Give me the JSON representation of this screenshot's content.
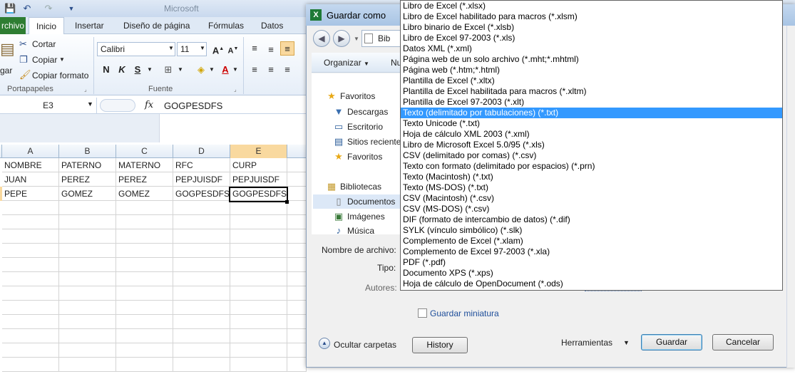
{
  "excel": {
    "title": "Microsoft",
    "tabs": {
      "file": "rchivo",
      "inicio": "Inicio",
      "insertar": "Insertar",
      "diseno": "Diseño de página",
      "formulas": "Fórmulas",
      "datos": "Datos"
    },
    "clipboard": {
      "paste": "gar",
      "cut": "Cortar",
      "copy": "Copiar",
      "copy_format": "Copiar formato",
      "group": "Portapapeles"
    },
    "font": {
      "name": "Calibri",
      "size": "11",
      "group": "Fuente",
      "bold": "N",
      "italic": "K",
      "underline": "S"
    },
    "name_box": "E3",
    "fx": "fx",
    "formula_value": "GOGPESDFS",
    "columns": [
      "A",
      "B",
      "C",
      "D",
      "E"
    ],
    "rows": [
      [
        "NOMBRE",
        "PATERNO",
        "MATERNO",
        "RFC",
        "CURP"
      ],
      [
        "JUAN",
        "PEREZ",
        "PEREZ",
        "PEPJUISDF",
        "PEPJUISDF"
      ],
      [
        "PEPE",
        "GOMEZ",
        "GOMEZ",
        "GOGPESDFS",
        "GOGPESDFS"
      ]
    ]
  },
  "dialog": {
    "title": "Guardar como",
    "address": "Bib",
    "organizar": "Organizar",
    "nuevo": "Nu",
    "nav": {
      "favoritos": "Favoritos",
      "descargas": "Descargas",
      "escritorio": "Escritorio",
      "sitios": "Sitios recientes",
      "favoritos2": "Favoritos",
      "bibliotecas": "Bibliotecas",
      "documentos": "Documentos",
      "imagenes": "Imágenes",
      "musica": "Música"
    },
    "labels": {
      "filename": "Nombre de archivo:",
      "type": "Tipo:",
      "authors": "Autores:"
    },
    "save_thumbnail": "Guardar miniatura",
    "hide_folders": "Ocultar carpetas",
    "history_button": "History",
    "tools": "Herramientas",
    "save_button": "Guardar",
    "cancel_button": "Cancelar"
  },
  "file_types": [
    "Libro de Excel (*.xlsx)",
    "Libro de Excel habilitado para macros (*.xlsm)",
    "Libro binario de Excel (*.xlsb)",
    "Libro de Excel 97-2003 (*.xls)",
    "Datos XML (*.xml)",
    "Página web de un solo archivo (*.mht;*.mhtml)",
    "Página web (*.htm;*.html)",
    "Plantilla de Excel (*.xltx)",
    "Plantilla de Excel habilitada para macros (*.xltm)",
    "Plantilla de Excel 97-2003 (*.xlt)",
    "Texto (delimitado por tabulaciones) (*.txt)",
    "Texto Unicode (*.txt)",
    "Hoja de cálculo XML 2003 (*.xml)",
    "Libro de Microsoft Excel 5.0/95 (*.xls)",
    "CSV (delimitado por comas) (*.csv)",
    "Texto con formato (delimitado por espacios) (*.prn)",
    "Texto (Macintosh) (*.txt)",
    "Texto (MS-DOS) (*.txt)",
    "CSV (Macintosh) (*.csv)",
    "CSV (MS-DOS) (*.csv)",
    "DIF (formato de intercambio de datos) (*.dif)",
    "SYLK (vínculo simbólico) (*.slk)",
    "Complemento de Excel (*.xlam)",
    "Complemento de Excel 97-2003 (*.xla)",
    "PDF (*.pdf)",
    "Documento XPS (*.xps)",
    "Hoja de cálculo de OpenDocument (*.ods)"
  ],
  "selected_file_type_index": 10
}
